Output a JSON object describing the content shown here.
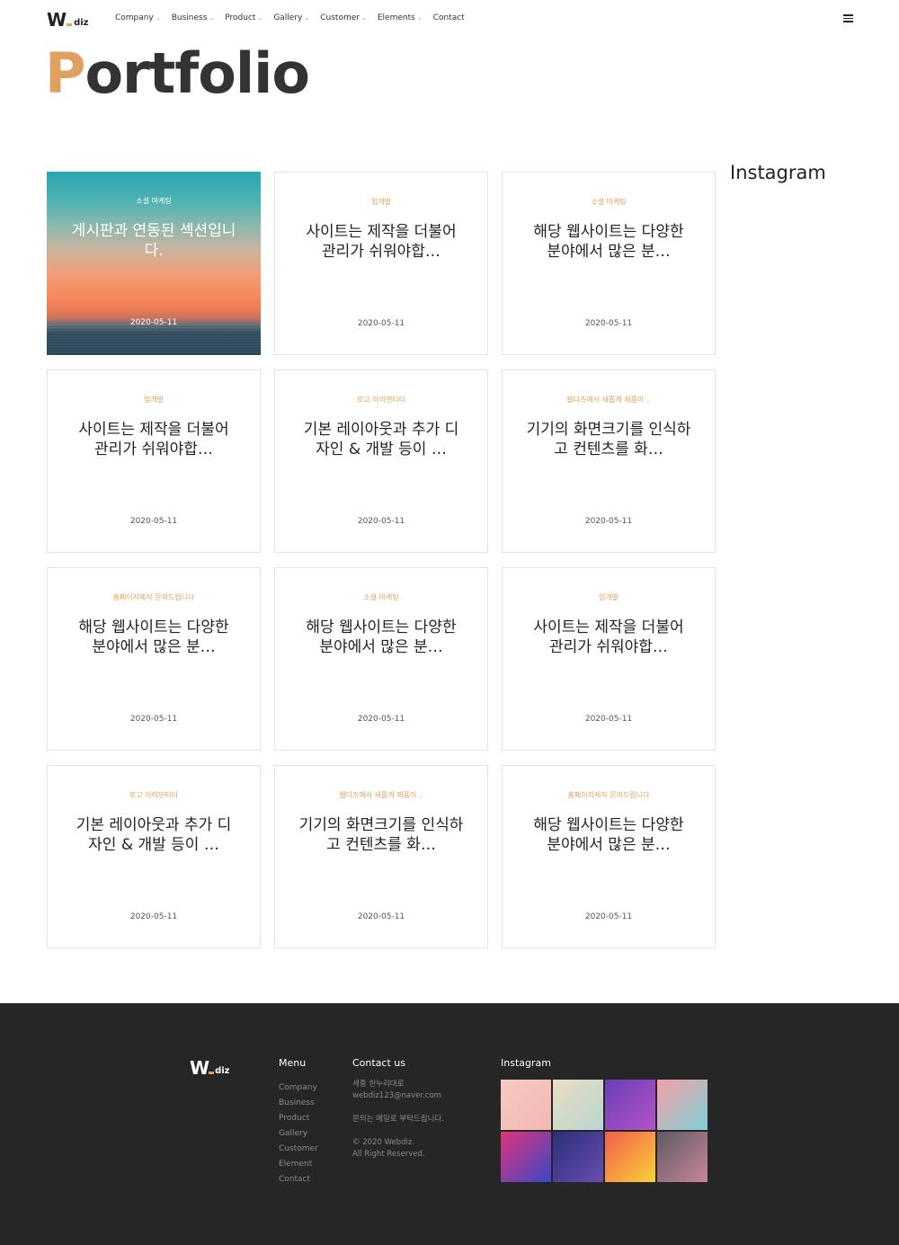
{
  "header": {
    "logo_mark": "W",
    "logo_text": "diz",
    "nav": [
      "Company",
      "Business",
      "Product",
      "Gallery",
      "Customer",
      "Elements",
      "Contact"
    ],
    "nav_with_chevron": [
      true,
      true,
      true,
      true,
      true,
      true,
      false
    ]
  },
  "page": {
    "title_first": "P",
    "title_rest": "ortfolio"
  },
  "cards": [
    {
      "category": "소셜 마케팅",
      "title": "게시판과 연동된 섹션입니다.",
      "date": "2020-05-11",
      "featured": true
    },
    {
      "category": "업개발",
      "title": "사이트는 제작을 더불어 관리가 쉬워야합…",
      "date": "2020-05-11"
    },
    {
      "category": "소셜 마케팅",
      "title": "해당 웹사이트는 다양한 분야에서 많은 분…",
      "date": "2020-05-11"
    },
    {
      "category": "업개발",
      "title": "사이트는 제작을 더불어 관리가 쉬워야합…",
      "date": "2020-05-11"
    },
    {
      "category": "로고 아이덴티티",
      "title": "기본 레이아웃과 추가 디자인 & 개발 등이 …",
      "date": "2020-05-11"
    },
    {
      "category": "웹디즈에서 새롭게 제품이 ..",
      "title": "기기의 화면크기를 인식하고 컨텐츠를 화…",
      "date": "2020-05-11"
    },
    {
      "category": "홈페이지제작 문의드립니다",
      "title": "해당 웹사이트는 다양한 분야에서 많은 분…",
      "date": "2020-05-11"
    },
    {
      "category": "소셜 마케팅",
      "title": "해당 웹사이트는 다양한 분야에서 많은 분…",
      "date": "2020-05-11"
    },
    {
      "category": "업개발",
      "title": "사이트는 제작을 더불어 관리가 쉬워야합…",
      "date": "2020-05-11"
    },
    {
      "category": "로고 아이덴티티",
      "title": "기본 레이아웃과 추가 디자인 & 개발 등이 …",
      "date": "2020-05-11"
    },
    {
      "category": "웹디즈에서 새롭게 제품이 ..",
      "title": "기기의 화면크기를 인식하고 컨텐츠를 화…",
      "date": "2020-05-11"
    },
    {
      "category": "홈페이지제작 문의드립니다",
      "title": "해당 웹사이트는 다양한 분야에서 많은 분…",
      "date": "2020-05-11"
    }
  ],
  "sidebar": {
    "title": "Instagram"
  },
  "footer": {
    "logo_mark": "W",
    "logo_text": "diz",
    "menu_title": "Menu",
    "menu": [
      "Company",
      "Business",
      "Product",
      "Gallery",
      "Customer",
      "Element",
      "Contact"
    ],
    "contact_title": "Contact us",
    "contact_address": "세종 한누리대로",
    "contact_email": "webdiz123@naver.com",
    "contact_note": "문의는 메일로 부탁드립니다.",
    "copyright_line1": "© 2020 Webdiz.",
    "copyright_line2": "All Right Reserved.",
    "instagram_title": "Instagram",
    "instagram_tiles": [
      {
        "name": "insta-photo-pattern",
        "colors": [
          "#f6c9c4",
          "#f3b8b2"
        ]
      },
      {
        "name": "insta-photo-illustration",
        "colors": [
          "#e9ddc4",
          "#b9d6cf"
        ]
      },
      {
        "name": "insta-photo-purple-smoke",
        "colors": [
          "#6a3fb8",
          "#b453c8"
        ]
      },
      {
        "name": "insta-photo-pink-paint",
        "colors": [
          "#f3a0a8",
          "#7fd0d5"
        ]
      },
      {
        "name": "insta-photo-neon-corridor",
        "colors": [
          "#e0347a",
          "#3a48c8"
        ]
      },
      {
        "name": "insta-photo-starry-sky",
        "colors": [
          "#2b2f7a",
          "#6a4db0"
        ]
      },
      {
        "name": "insta-photo-color-rings",
        "colors": [
          "#f25d4a",
          "#f8d238"
        ]
      },
      {
        "name": "insta-photo-bottle",
        "colors": [
          "#5e5a66",
          "#c9869a"
        ]
      }
    ]
  }
}
